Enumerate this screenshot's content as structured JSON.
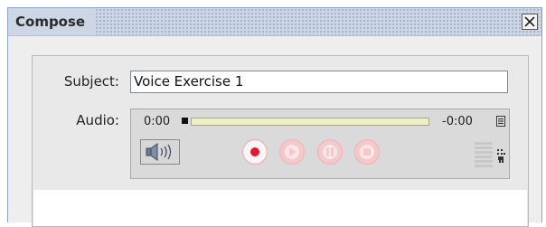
{
  "window": {
    "title": "Compose"
  },
  "subject": {
    "label": "Subject:",
    "value": "Voice Exercise 1"
  },
  "audio": {
    "label": "Audio:",
    "elapsed": "0:00",
    "remaining": "-0:00"
  },
  "icons": {
    "close": "close-icon",
    "menu": "menu-icon",
    "volume": "speaker-icon",
    "record": "record-icon",
    "play": "play-icon",
    "pause": "pause-icon",
    "stop": "stop-icon",
    "level": "level-meter-icon",
    "grip": "drag-handle-icon"
  },
  "colors": {
    "record": "#e8162b",
    "disabled_control": "#f4c9cc",
    "titlebar": "#ccd6e4"
  }
}
